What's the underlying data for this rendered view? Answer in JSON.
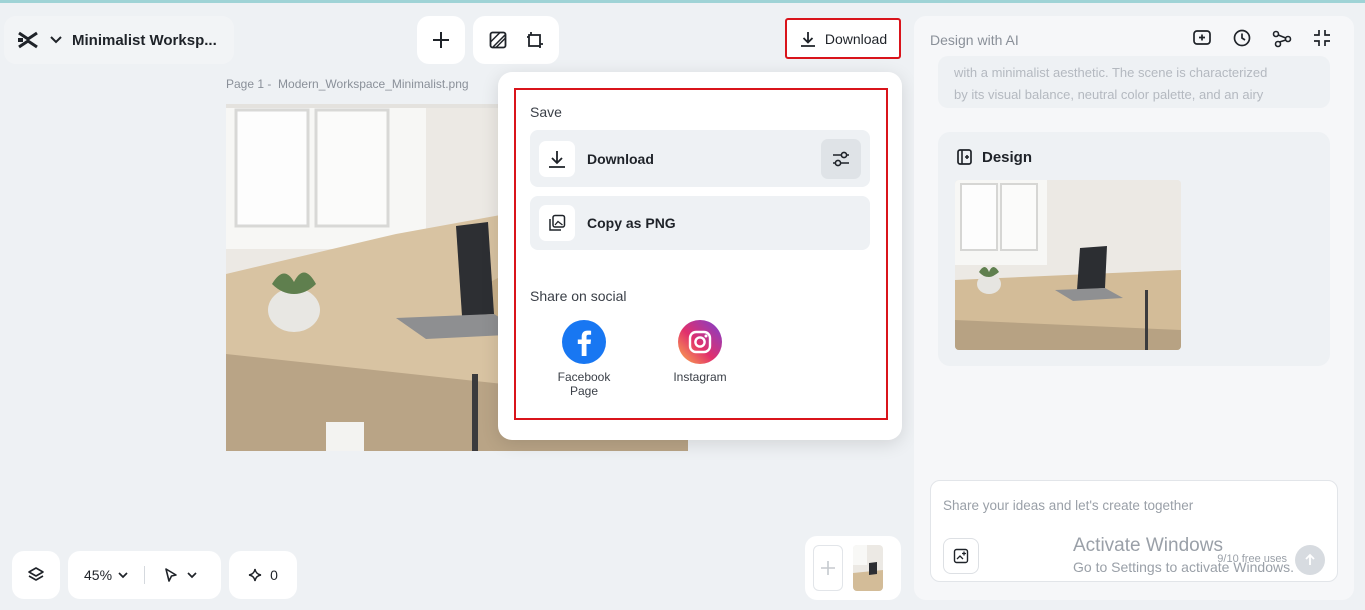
{
  "project": {
    "name": "Minimalist Worksp..."
  },
  "toolbar": {
    "download_label": "Download"
  },
  "canvas": {
    "page_label": "Page 1 -",
    "file_name": "Modern_Workspace_Minimalist.png"
  },
  "popup": {
    "save_title": "Save",
    "download_label": "Download",
    "copy_label": "Copy as PNG",
    "share_title": "Share on social",
    "social": [
      {
        "label_line1": "Facebook",
        "label_line2": "Page"
      },
      {
        "label_line1": "Instagram"
      }
    ]
  },
  "right_panel": {
    "title": "Design with AI",
    "description_line1": "with a minimalist aesthetic. The scene is characterized",
    "description_line2": "by its visual balance, neutral color palette, and an airy",
    "design_title": "Design",
    "input_placeholder": "Share your ideas and let's create together",
    "usage": "9/10 free uses"
  },
  "bottom": {
    "zoom": "45%",
    "credits": "0"
  },
  "overlay": {
    "activate_title": "Activate Windows",
    "activate_sub": "Go to Settings to activate Windows."
  },
  "colors": {
    "highlight": "#d9141b",
    "facebook": "#1877f2",
    "background": "#eef1f4"
  }
}
